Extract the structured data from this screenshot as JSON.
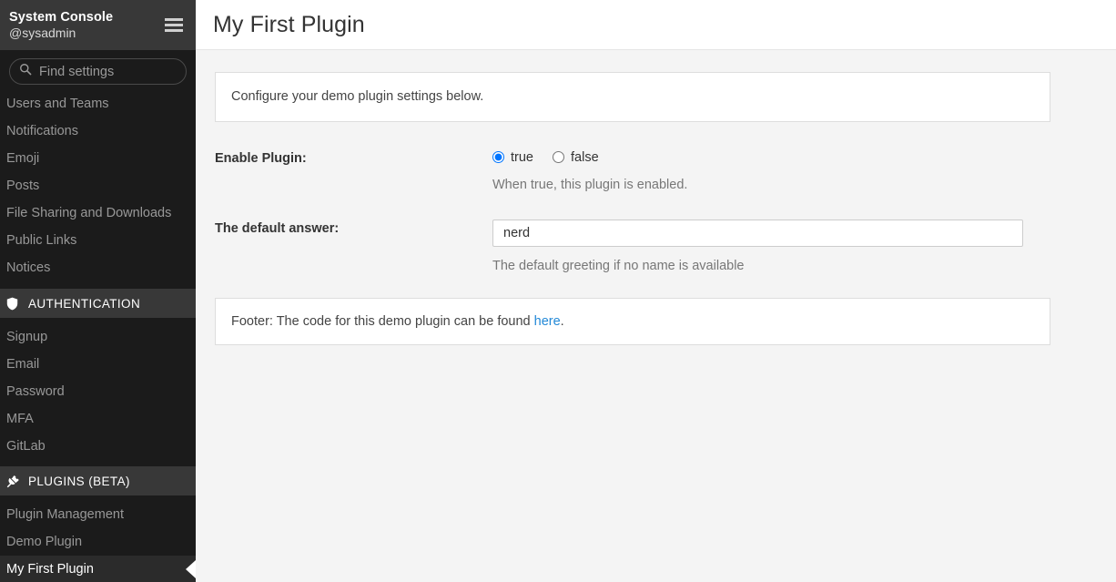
{
  "sidebar": {
    "title": "System Console",
    "username": "@sysadmin",
    "menu_icon": "hamburger-menu-icon",
    "search": {
      "icon": "search-icon",
      "placeholder": "Find settings",
      "value": ""
    },
    "top_items": [
      {
        "label": "Users and Teams",
        "active": false
      },
      {
        "label": "Notifications",
        "active": false
      },
      {
        "label": "Emoji",
        "active": false
      },
      {
        "label": "Posts",
        "active": false
      },
      {
        "label": "File Sharing and Downloads",
        "active": false
      },
      {
        "label": "Public Links",
        "active": false
      },
      {
        "label": "Notices",
        "active": false
      }
    ],
    "sections": [
      {
        "label": "AUTHENTICATION",
        "icon": "shield-icon",
        "items": [
          {
            "label": "Signup",
            "active": false
          },
          {
            "label": "Email",
            "active": false
          },
          {
            "label": "Password",
            "active": false
          },
          {
            "label": "MFA",
            "active": false
          },
          {
            "label": "GitLab",
            "active": false
          }
        ]
      },
      {
        "label": "PLUGINS (BETA)",
        "icon": "plug-icon",
        "items": [
          {
            "label": "Plugin Management",
            "active": false
          },
          {
            "label": "Demo Plugin",
            "active": false
          },
          {
            "label": "My First Plugin",
            "active": true
          }
        ]
      }
    ]
  },
  "header": {
    "title": "My First Plugin"
  },
  "main": {
    "intro_banner": "Configure your demo plugin settings below.",
    "settings": [
      {
        "label": "Enable Plugin:",
        "type": "radio",
        "options": [
          {
            "label": "true",
            "value": "true",
            "checked": true
          },
          {
            "label": "false",
            "value": "false",
            "checked": false
          }
        ],
        "help": "When true, this plugin is enabled."
      },
      {
        "label": "The default answer:",
        "type": "text",
        "value": "nerd",
        "placeholder": "",
        "help": "The default greeting if no name is available"
      }
    ],
    "footer_banner": {
      "text_before": "Footer: The code for this demo plugin can be found ",
      "link_text": "here",
      "text_after": "."
    }
  },
  "colors": {
    "sidebar_bg": "#1b1b1b",
    "sidebar_header_bg": "#383838",
    "active_item_bg": "#2b2b2b",
    "content_bg": "#f4f4f4",
    "link": "#2389d7"
  }
}
